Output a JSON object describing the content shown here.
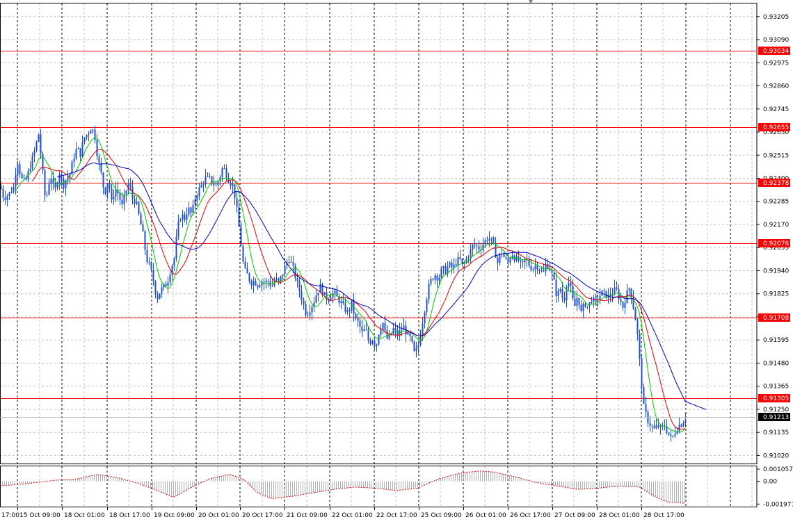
{
  "chart_data": [
    {
      "type": "candlestick",
      "indicators": [
        "SMA fast (green)",
        "SMA medium (red)",
        "SMA slow (blue)"
      ],
      "y_ticks": [
        "0.93205",
        "0.93090",
        "0.92975",
        "0.92860",
        "0.92745",
        "0.92630",
        "0.92515",
        "0.92400",
        "0.92285",
        "0.92170",
        "0.92055",
        "0.91940",
        "0.91825",
        "0.91710",
        "0.91595",
        "0.91480",
        "0.91365",
        "0.91250",
        "0.91135",
        "0.91020"
      ],
      "ylim": [
        0.9098,
        0.9327
      ],
      "x_labels": [
        "17:00",
        "15 Oct 09:00",
        "18 Oct 01:00",
        "18 Oct 17:00",
        "19 Oct 09:00",
        "20 Oct 01:00",
        "20 Oct 17:00",
        "21 Oct 09:00",
        "22 Oct 01:00",
        "22 Oct 17:00",
        "25 Oct 09:00",
        "26 Oct 01:00",
        "26 Oct 17:00",
        "27 Oct 09:00",
        "28 Oct 01:00",
        "28 Oct 17:00"
      ],
      "horizontal_levels": [
        "0.93034",
        "0.92655",
        "0.92378",
        "0.92076",
        "0.91708",
        "0.91305"
      ],
      "current_price": "0.91213",
      "level_color": "#ff0000",
      "candle_color": "#1f4fcc",
      "ma_colors": [
        "#00c800",
        "#e00000",
        "#0000c0"
      ],
      "anchors": [
        [
          0,
          0.9236
        ],
        [
          5,
          0.923
        ],
        [
          12,
          0.9232
        ],
        [
          20,
          0.9236
        ],
        [
          24,
          0.925
        ],
        [
          30,
          0.924
        ],
        [
          36,
          0.9238
        ],
        [
          42,
          0.9245
        ],
        [
          48,
          0.9252
        ],
        [
          55,
          0.9262
        ],
        [
          60,
          0.9246
        ],
        [
          65,
          0.9228
        ],
        [
          72,
          0.9242
        ],
        [
          78,
          0.9233
        ],
        [
          85,
          0.9243
        ],
        [
          90,
          0.9236
        ],
        [
          95,
          0.924
        ],
        [
          100,
          0.9242
        ],
        [
          105,
          0.925
        ],
        [
          110,
          0.9255
        ],
        [
          115,
          0.9252
        ],
        [
          120,
          0.926
        ],
        [
          125,
          0.9262
        ],
        [
          130,
          0.9265
        ],
        [
          135,
          0.9263
        ],
        [
          140,
          0.925
        ],
        [
          145,
          0.9242
        ],
        [
          150,
          0.9232
        ],
        [
          155,
          0.924
        ],
        [
          160,
          0.9228
        ],
        [
          165,
          0.9235
        ],
        [
          170,
          0.9232
        ],
        [
          175,
          0.9226
        ],
        [
          180,
          0.9233
        ],
        [
          185,
          0.9238
        ],
        [
          190,
          0.923
        ],
        [
          195,
          0.9228
        ],
        [
          200,
          0.922
        ],
        [
          205,
          0.9212
        ],
        [
          210,
          0.92
        ],
        [
          215,
          0.9196
        ],
        [
          220,
          0.9189
        ],
        [
          225,
          0.918
        ],
        [
          230,
          0.9184
        ],
        [
          235,
          0.9186
        ],
        [
          240,
          0.9188
        ],
        [
          245,
          0.9195
        ],
        [
          250,
          0.92
        ],
        [
          255,
          0.9216
        ],
        [
          260,
          0.9222
        ],
        [
          265,
          0.922
        ],
        [
          270,
          0.9225
        ],
        [
          275,
          0.9222
        ],
        [
          280,
          0.923
        ],
        [
          285,
          0.9234
        ],
        [
          290,
          0.9237
        ],
        [
          295,
          0.924
        ],
        [
          300,
          0.924
        ],
        [
          305,
          0.9238
        ],
        [
          310,
          0.9236
        ],
        [
          315,
          0.924
        ],
        [
          320,
          0.9246
        ],
        [
          325,
          0.9242
        ],
        [
          330,
          0.9238
        ],
        [
          335,
          0.9236
        ],
        [
          340,
          0.9224
        ],
        [
          345,
          0.921
        ],
        [
          350,
          0.9195
        ],
        [
          355,
          0.9192
        ],
        [
          360,
          0.9188
        ],
        [
          365,
          0.9189
        ],
        [
          370,
          0.9187
        ],
        [
          375,
          0.9189
        ],
        [
          380,
          0.9188
        ],
        [
          385,
          0.9189
        ],
        [
          390,
          0.9186
        ],
        [
          395,
          0.919
        ],
        [
          400,
          0.9188
        ],
        [
          405,
          0.9192
        ],
        [
          410,
          0.9197
        ],
        [
          415,
          0.92
        ],
        [
          420,
          0.9196
        ],
        [
          425,
          0.919
        ],
        [
          430,
          0.9184
        ],
        [
          435,
          0.9178
        ],
        [
          440,
          0.9172
        ],
        [
          445,
          0.9175
        ],
        [
          450,
          0.9178
        ],
        [
          455,
          0.9183
        ],
        [
          460,
          0.9186
        ],
        [
          465,
          0.9182
        ],
        [
          470,
          0.918
        ],
        [
          475,
          0.9182
        ],
        [
          480,
          0.9183
        ],
        [
          485,
          0.918
        ],
        [
          490,
          0.9178
        ],
        [
          495,
          0.9175
        ],
        [
          500,
          0.9173
        ],
        [
          505,
          0.9178
        ],
        [
          510,
          0.917
        ],
        [
          515,
          0.9168
        ],
        [
          520,
          0.9163
        ],
        [
          525,
          0.9165
        ],
        [
          530,
          0.9158
        ],
        [
          535,
          0.916
        ],
        [
          540,
          0.9156
        ],
        [
          545,
          0.9165
        ],
        [
          550,
          0.9168
        ],
        [
          555,
          0.916
        ],
        [
          560,
          0.9161
        ],
        [
          565,
          0.9165
        ],
        [
          570,
          0.9162
        ],
        [
          575,
          0.9164
        ],
        [
          580,
          0.9166
        ],
        [
          585,
          0.9162
        ],
        [
          590,
          0.916
        ],
        [
          595,
          0.9153
        ],
        [
          600,
          0.9155
        ],
        [
          605,
          0.9165
        ],
        [
          610,
          0.9175
        ],
        [
          615,
          0.9185
        ],
        [
          620,
          0.919
        ],
        [
          625,
          0.9192
        ],
        [
          630,
          0.919
        ],
        [
          635,
          0.9195
        ],
        [
          640,
          0.9194
        ],
        [
          645,
          0.9197
        ],
        [
          650,
          0.9195
        ],
        [
          655,
          0.9198
        ],
        [
          660,
          0.92
        ],
        [
          665,
          0.9196
        ],
        [
          670,
          0.92
        ],
        [
          675,
          0.9203
        ],
        [
          680,
          0.9207
        ],
        [
          685,
          0.9206
        ],
        [
          690,
          0.9205
        ],
        [
          695,
          0.9208
        ],
        [
          700,
          0.921
        ],
        [
          705,
          0.921
        ],
        [
          710,
          0.9205
        ],
        [
          715,
          0.9198
        ],
        [
          720,
          0.9204
        ],
        [
          725,
          0.92
        ],
        [
          730,
          0.9198
        ],
        [
          735,
          0.9203
        ],
        [
          740,
          0.92
        ],
        [
          745,
          0.9199
        ],
        [
          750,
          0.9196
        ],
        [
          755,
          0.92
        ],
        [
          760,
          0.9197
        ],
        [
          765,
          0.9195
        ],
        [
          770,
          0.9197
        ],
        [
          775,
          0.9195
        ],
        [
          780,
          0.9192
        ],
        [
          785,
          0.9198
        ],
        [
          790,
          0.9195
        ],
        [
          795,
          0.919
        ],
        [
          800,
          0.9181
        ],
        [
          805,
          0.9185
        ],
        [
          810,
          0.9178
        ],
        [
          815,
          0.919
        ],
        [
          820,
          0.9185
        ],
        [
          825,
          0.9175
        ],
        [
          830,
          0.9182
        ],
        [
          835,
          0.9173
        ],
        [
          840,
          0.9178
        ],
        [
          845,
          0.9176
        ],
        [
          850,
          0.918
        ],
        [
          855,
          0.9178
        ],
        [
          860,
          0.9181
        ],
        [
          865,
          0.9183
        ],
        [
          870,
          0.9182
        ],
        [
          875,
          0.9181
        ],
        [
          880,
          0.9183
        ],
        [
          885,
          0.9185
        ],
        [
          890,
          0.918
        ],
        [
          895,
          0.9176
        ],
        [
          900,
          0.9182
        ],
        [
          905,
          0.9186
        ],
        [
          910,
          0.9176
        ],
        [
          915,
          0.9166
        ],
        [
          920,
          0.9145
        ],
        [
          925,
          0.9126
        ],
        [
          930,
          0.912
        ],
        [
          935,
          0.9117
        ],
        [
          940,
          0.9115
        ],
        [
          945,
          0.9117
        ],
        [
          950,
          0.9115
        ],
        [
          955,
          0.9117
        ],
        [
          960,
          0.9113
        ],
        [
          965,
          0.911
        ],
        [
          970,
          0.9114
        ],
        [
          975,
          0.9117
        ],
        [
          980,
          0.9118
        ],
        [
          985,
          0.9121
        ]
      ],
      "osc_ticks": [
        "0.001057",
        "0.00",
        "-0.001977"
      ],
      "osc_range": [
        -0.0022,
        0.0013
      ],
      "osc_anchors": [
        [
          0,
          -0.0004
        ],
        [
          40,
          -0.0002
        ],
        [
          80,
          0.0001
        ],
        [
          110,
          0.0002
        ],
        [
          140,
          0.0006
        ],
        [
          170,
          0.0003
        ],
        [
          200,
          -0.0002
        ],
        [
          230,
          -0.0009
        ],
        [
          250,
          -0.0014
        ],
        [
          270,
          -0.0007
        ],
        [
          300,
          0.0002
        ],
        [
          330,
          0.0006
        ],
        [
          350,
          0.0002
        ],
        [
          370,
          -0.001
        ],
        [
          390,
          -0.0015
        ],
        [
          420,
          -0.0013
        ],
        [
          450,
          -0.001
        ],
        [
          480,
          -0.0007
        ],
        [
          510,
          -0.0005
        ],
        [
          540,
          -0.0006
        ],
        [
          570,
          -0.0008
        ],
        [
          600,
          -0.0006
        ],
        [
          630,
          0.0002
        ],
        [
          660,
          0.0007
        ],
        [
          690,
          0.0009
        ],
        [
          710,
          0.0008
        ],
        [
          740,
          0.0004
        ],
        [
          770,
          -0.0001
        ],
        [
          800,
          -0.0004
        ],
        [
          830,
          -0.0007
        ],
        [
          860,
          -0.0006
        ],
        [
          890,
          -0.0004
        ],
        [
          920,
          -0.0005
        ],
        [
          940,
          -0.0013
        ],
        [
          960,
          -0.0018
        ],
        [
          985,
          -0.0019
        ]
      ]
    }
  ]
}
